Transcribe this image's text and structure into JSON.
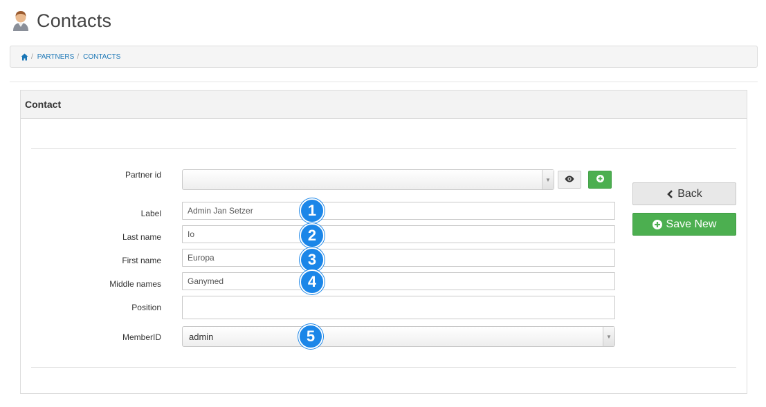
{
  "page": {
    "title": "Contacts"
  },
  "breadcrumb": {
    "items": [
      "PARTNERS",
      "CONTACTS"
    ],
    "separator": "/"
  },
  "panel": {
    "title": "Contact"
  },
  "form": {
    "partner_id": {
      "label": "Partner id",
      "value": ""
    },
    "label": {
      "label": "Label",
      "value": "Admin Jan Setzer"
    },
    "last_name": {
      "label": "Last name",
      "value": "Io"
    },
    "first_name": {
      "label": "First name",
      "value": "Europa"
    },
    "middle_names": {
      "label": "Middle names",
      "value": "Ganymed"
    },
    "position": {
      "label": "Position",
      "value": ""
    },
    "member_id": {
      "label": "MemberID",
      "value": "admin"
    }
  },
  "actions": {
    "back_label": "Back",
    "save_new_label": "Save New"
  },
  "badges": [
    "1",
    "2",
    "3",
    "4",
    "5"
  ],
  "colors": {
    "accent_blue": "#1a76b6",
    "success_green": "#4caf50",
    "badge_blue": "#1b86e8"
  },
  "icons": {
    "header": "user-contact-icon",
    "home": "home-icon",
    "view": "eye-icon",
    "add": "plus-circle-icon",
    "back": "chevron-left-icon",
    "save": "plus-circle-icon",
    "dropdown": "caret-down-icon"
  }
}
